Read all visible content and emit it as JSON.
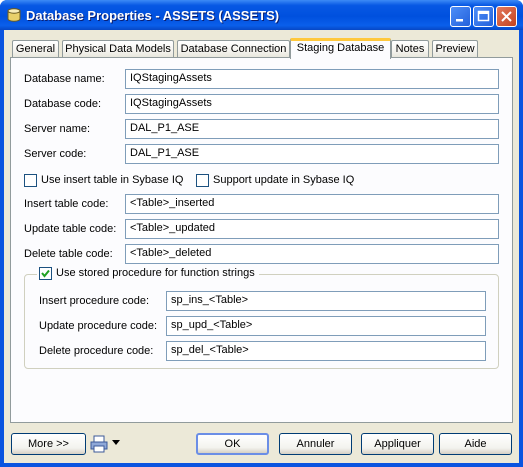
{
  "window": {
    "title": "Database Properties - ASSETS (ASSETS)"
  },
  "tabs": [
    {
      "label": "General"
    },
    {
      "label": "Physical Data Models"
    },
    {
      "label": "Database Connection"
    },
    {
      "label": "Staging Database"
    },
    {
      "label": "Notes"
    },
    {
      "label": "Preview"
    }
  ],
  "fields": {
    "database_name": {
      "label": "Database name:",
      "value": "IQStagingAssets"
    },
    "database_code": {
      "label": "Database code:",
      "value": "IQStagingAssets"
    },
    "server_name": {
      "label": "Server name:",
      "value": "DAL_P1_ASE"
    },
    "server_code": {
      "label": "Server code:",
      "value": "DAL_P1_ASE"
    },
    "insert_table_code": {
      "label": "Insert table code:",
      "value": "<Table>_inserted"
    },
    "update_table_code": {
      "label": "Update table code:",
      "value": "<Table>_updated"
    },
    "delete_table_code": {
      "label": "Delete table code:",
      "value": "<Table>_deleted"
    }
  },
  "checkboxes": {
    "use_insert_table": {
      "label": "Use insert table in Sybase IQ",
      "checked": false
    },
    "support_update": {
      "label": "Support update in Sybase IQ",
      "checked": false
    },
    "use_stored_procedure": {
      "label": "Use stored procedure for function strings",
      "checked": true
    }
  },
  "procedures": {
    "insert": {
      "label": "Insert procedure code:",
      "value": "sp_ins_<Table>"
    },
    "update": {
      "label": "Update procedure code:",
      "value": "sp_upd_<Table>"
    },
    "delete": {
      "label": "Delete procedure code:",
      "value": "sp_del_<Table>"
    }
  },
  "buttons": {
    "more": "More >>",
    "ok": "OK",
    "cancel": "Annuler",
    "apply": "Appliquer",
    "help": "Aide"
  },
  "icons": {
    "app": "database-icon",
    "print": "print-icon",
    "dropdown": "triangle-down-icon"
  }
}
